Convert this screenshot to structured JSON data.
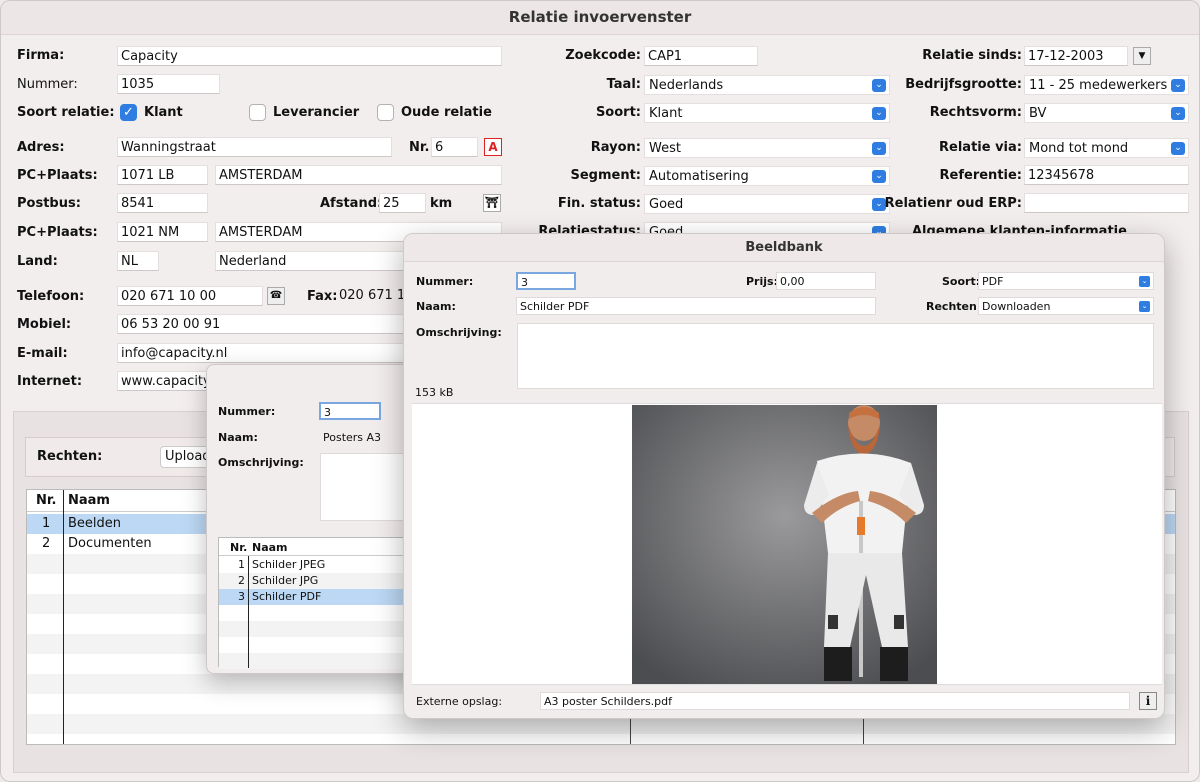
{
  "main_window": {
    "title": "Relatie invoervenster",
    "left": {
      "firma_label": "Firma:",
      "firma_value": "Capacity",
      "nummer_label": "Nummer:",
      "nummer_value": "1035",
      "soort_relatie_label": "Soort relatie:",
      "klant_label": "Klant",
      "leverancier_label": "Leverancier",
      "oude_relatie_label": "Oude relatie",
      "adres_label": "Adres:",
      "adres_value": "Wanningstraat",
      "nr_label": "Nr.",
      "nr_value": "6",
      "pc_plaats1_label": "PC+Plaats:",
      "pc1_value": "1071 LB",
      "plaats1_value": "AMSTERDAM",
      "postbus_label": "Postbus:",
      "postbus_value": "8541",
      "afstand_label": "Afstand:",
      "afstand_value": "25",
      "km_label": "km",
      "pc_plaats2_label": "PC+Plaats:",
      "pc2_value": "1021 NM",
      "plaats2_value": "AMSTERDAM",
      "land_label": "Land:",
      "land_code": "NL",
      "land_value": "Nederland",
      "telefoon_label": "Telefoon:",
      "telefoon_value": "020 671 10 00",
      "fax_label": "Fax:",
      "fax_value": "020 671 1",
      "mobiel_label": "Mobiel:",
      "mobiel_value": "06 53 20 00 91",
      "email_label": "E-mail:",
      "email_value": "info@capacity.nl",
      "internet_label": "Internet:",
      "internet_value": "www.capacity"
    },
    "middle": {
      "zoekcode_label": "Zoekcode:",
      "zoekcode_value": "CAP1",
      "taal_label": "Taal:",
      "taal_value": "Nederlands",
      "soort_label": "Soort:",
      "soort_value": "Klant",
      "rayon_label": "Rayon:",
      "rayon_value": "West",
      "segment_label": "Segment:",
      "segment_value": "Automatisering",
      "fin_status_label": "Fin. status:",
      "fin_status_value": "Goed",
      "relatiestatus_label": "Relatiestatus:",
      "relatiestatus_value": "Goed"
    },
    "right": {
      "relatie_sinds_label": "Relatie sinds:",
      "relatie_sinds_value": "17-12-2003",
      "bedrijfsgrootte_label": "Bedrijfsgrootte:",
      "bedrijfsgrootte_value": "11 - 25 medewerkers",
      "rechtsvorm_label": "Rechtsvorm:",
      "rechtsvorm_value": "BV",
      "relatie_via_label": "Relatie via:",
      "relatie_via_value": "Mond tot mond",
      "referentie_label": "Referentie:",
      "referentie_value": "12345678",
      "relatienr_erp_label": "Relatienr oud ERP:",
      "relatienr_erp_value": "",
      "algemene_label": "Algemene klanten-informatie"
    },
    "lower": {
      "rechten_label": "Rechten:",
      "upload_label": "Upload",
      "col_nr": "Nr.",
      "col_naam": "Naam",
      "rows": [
        {
          "nr": "1",
          "naam": "Beelden"
        },
        {
          "nr": "2",
          "naam": "Documenten"
        }
      ]
    }
  },
  "posters_window": {
    "nummer_label": "Nummer:",
    "nummer_value": "3",
    "naam_label": "Naam:",
    "naam_value": "Posters A3",
    "omschrijving_label": "Omschrijving:",
    "col_nr": "Nr.",
    "col_naam": "Naam",
    "rows": [
      {
        "nr": "1",
        "naam": "Schilder JPEG"
      },
      {
        "nr": "2",
        "naam": "Schilder JPG"
      },
      {
        "nr": "3",
        "naam": "Schilder PDF"
      }
    ]
  },
  "beeldbank_window": {
    "title": "Beeldbank",
    "nummer_label": "Nummer:",
    "nummer_value": "3",
    "prijs_label": "Prijs:",
    "prijs_value": "0,00",
    "soort_label": "Soort:",
    "soort_value": "PDF",
    "naam_label": "Naam:",
    "naam_value": "Schilder PDF",
    "rechten_label": "Rechten:",
    "rechten_value": "Downloaden",
    "omschrijving_label": "Omschrijving:",
    "filesize": "153 kB",
    "externe_opslag_label": "Externe opslag:",
    "externe_opslag_value": "A3 poster Schilders.pdf",
    "info_button": "i"
  }
}
